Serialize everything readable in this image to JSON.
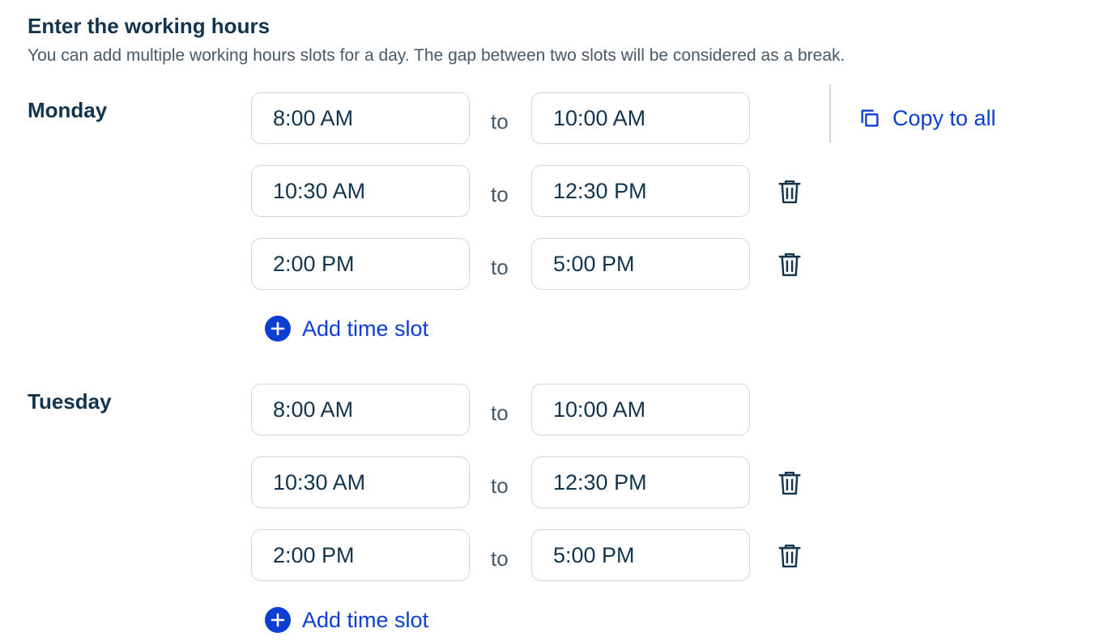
{
  "header": {
    "title": "Enter the working hours",
    "subtitle": "You can add multiple working hours slots for a day. The gap between two slots will be considered as a break."
  },
  "days": [
    {
      "name": "Monday",
      "slots": [
        {
          "start": "8:00 AM",
          "separator": "to",
          "end": "10:00 AM"
        },
        {
          "start": "10:30 AM",
          "separator": "to",
          "end": "12:30 PM"
        },
        {
          "start": "2:00 PM",
          "separator": "to",
          "end": "5:00 PM"
        }
      ],
      "copy_label": "Copy to all",
      "add_label": "Add time slot"
    },
    {
      "name": "Tuesday",
      "slots": [
        {
          "start": "8:00 AM",
          "separator": "to",
          "end": "10:00 AM"
        },
        {
          "start": "10:30 AM",
          "separator": "to",
          "end": "12:30 PM"
        },
        {
          "start": "2:00 PM",
          "separator": "to",
          "end": "5:00 PM"
        }
      ],
      "add_label": "Add time slot"
    }
  ],
  "icons": {
    "delete": "trash-icon",
    "copy": "copy-icon",
    "add": "plus-circle-icon"
  },
  "colors": {
    "text_primary": "#12344d",
    "text_secondary": "#475867",
    "link_blue": "#0b3ed1",
    "border": "#cfd7df"
  }
}
